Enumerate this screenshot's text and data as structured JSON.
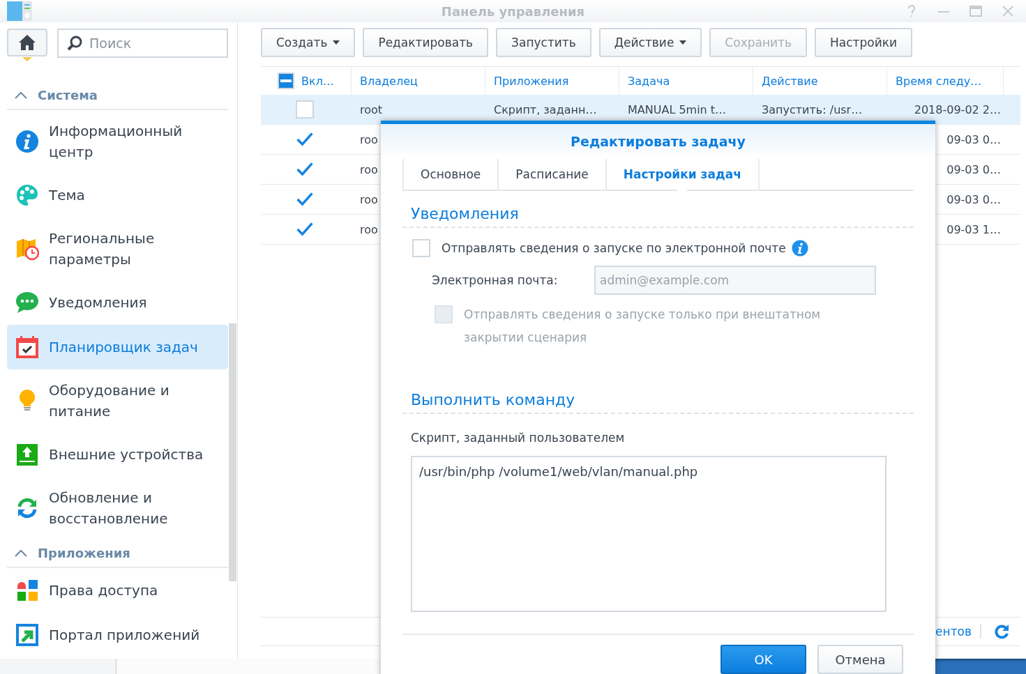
{
  "window": {
    "title": "Панель управления"
  },
  "sidebar": {
    "search": {
      "placeholder": "Поиск"
    },
    "sections": [
      {
        "title": "Система",
        "expanded": true,
        "items": [
          {
            "label": "Информационный центр",
            "selected": false
          },
          {
            "label": "Тема",
            "selected": false
          },
          {
            "label": "Региональные параметры",
            "selected": false
          },
          {
            "label": "Уведомления",
            "selected": false
          },
          {
            "label": "Планировщик задач",
            "selected": true
          },
          {
            "label": "Оборудование и питание",
            "selected": false
          },
          {
            "label": "Внешние устройства",
            "selected": false
          },
          {
            "label": "Обновление и восстановление",
            "selected": false
          }
        ]
      },
      {
        "title": "Приложения",
        "expanded": true,
        "items": [
          {
            "label": "Права доступа",
            "selected": false
          },
          {
            "label": "Портал приложений",
            "selected": false
          }
        ]
      }
    ]
  },
  "toolbar": {
    "buttons": [
      {
        "label": "Создать",
        "dropdown": true,
        "disabled": false
      },
      {
        "label": "Редактировать",
        "dropdown": false,
        "disabled": false
      },
      {
        "label": "Запустить",
        "dropdown": false,
        "disabled": false
      },
      {
        "label": "Действие",
        "dropdown": true,
        "disabled": false
      },
      {
        "label": "Сохранить",
        "dropdown": false,
        "disabled": true
      },
      {
        "label": "Настройки",
        "dropdown": false,
        "disabled": false
      }
    ]
  },
  "table": {
    "select_all_partial": true,
    "columns": [
      "Вкл…",
      "Владелец",
      "Приложения",
      "Задача",
      "Действие",
      "Время следу…"
    ],
    "rows": [
      {
        "enabled": false,
        "selected": true,
        "owner": "root",
        "application": "Скрипт, заданн…",
        "task": "MANUAL 5min t…",
        "action": "Запустить: /usr…",
        "next_run": "2018-09-02 2…"
      },
      {
        "enabled": true,
        "selected": false,
        "owner": "roo",
        "next_run": "09-03 0…"
      },
      {
        "enabled": true,
        "selected": false,
        "owner": "roo",
        "next_run": "09-03 0…"
      },
      {
        "enabled": true,
        "selected": false,
        "owner": "roo",
        "next_run": "09-03 0…"
      },
      {
        "enabled": true,
        "selected": false,
        "owner": "roo",
        "next_run": "09-03 1…"
      }
    ],
    "footer": {
      "status_text": "ентов"
    }
  },
  "dialog": {
    "title": "Редактировать задачу",
    "tabs": [
      {
        "label": "Основное",
        "selected": false
      },
      {
        "label": "Расписание",
        "selected": false
      },
      {
        "label": "Настройки задач",
        "selected": true
      }
    ],
    "notifications": {
      "title": "Уведомления",
      "send_email": {
        "label": "Отправлять сведения о запуске по электронной почте",
        "checked": false
      },
      "email": {
        "label": "Электронная почта:",
        "value": "admin@example.com",
        "disabled": true
      },
      "only_abnormal": {
        "label": "Отправлять сведения о запуске только при внештатном закрытии сценария",
        "checked": false,
        "disabled": true
      }
    },
    "command": {
      "title": "Выполнить команду",
      "label": "Скрипт, заданный пользователем",
      "script": "/usr/bin/php /volume1/web/vlan/manual.php"
    },
    "buttons": [
      {
        "label": "OK",
        "primary": true
      },
      {
        "label": "Отмена",
        "primary": false
      }
    ]
  }
}
